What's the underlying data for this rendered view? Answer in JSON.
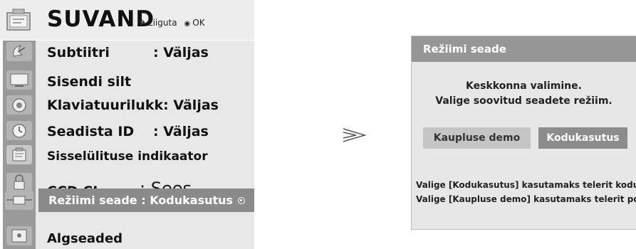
{
  "menu": {
    "title": "SUVAND",
    "hint_move": "Liiguta",
    "hint_ok": "OK",
    "rows": [
      {
        "label": "Subtiitri",
        "value": ": Väljas"
      },
      {
        "label": "Sisendi silt",
        "value": ""
      },
      {
        "label": "Klaviatuurilukk: Väljas",
        "value": ""
      },
      {
        "label": "Seadista ID",
        "value": ": Väljas"
      },
      {
        "label": "Sisselülituse indikaator",
        "value": ""
      },
      {
        "label": "CCD CI",
        "value": ": Sees"
      },
      {
        "label": "Režiimi seade : Kodukasutus",
        "value": ""
      },
      {
        "label": "Algseaded",
        "value": ""
      }
    ],
    "icons": [
      "tv-settings-icon",
      "satellite-dish-icon",
      "monitor-icon",
      "speaker-icon",
      "clock-icon",
      "option-icon",
      "lock-icon",
      "input-plug-icon",
      "support-icon"
    ]
  },
  "dialog": {
    "title": "Režiimi seade",
    "line1": "Keskkonna valimine.",
    "line2": "Valige soovitud seadete režiim.",
    "store_button": "Kaupluse demo",
    "home_button": "Kodukasutus",
    "note1": "Valige [Kodukasutus] kasutamaks telerit kodus.",
    "note2": "Valige [Kaupluse demo] kasutamaks telerit poes."
  },
  "colors": {
    "icon_column": "#9a9a9a",
    "menu_body": "#e8e8e8",
    "selected_row": "#8a8a8a",
    "dialog_titlebar": "#969696",
    "home_button": "#8c8c8c",
    "store_button": "#c5c5c5"
  }
}
